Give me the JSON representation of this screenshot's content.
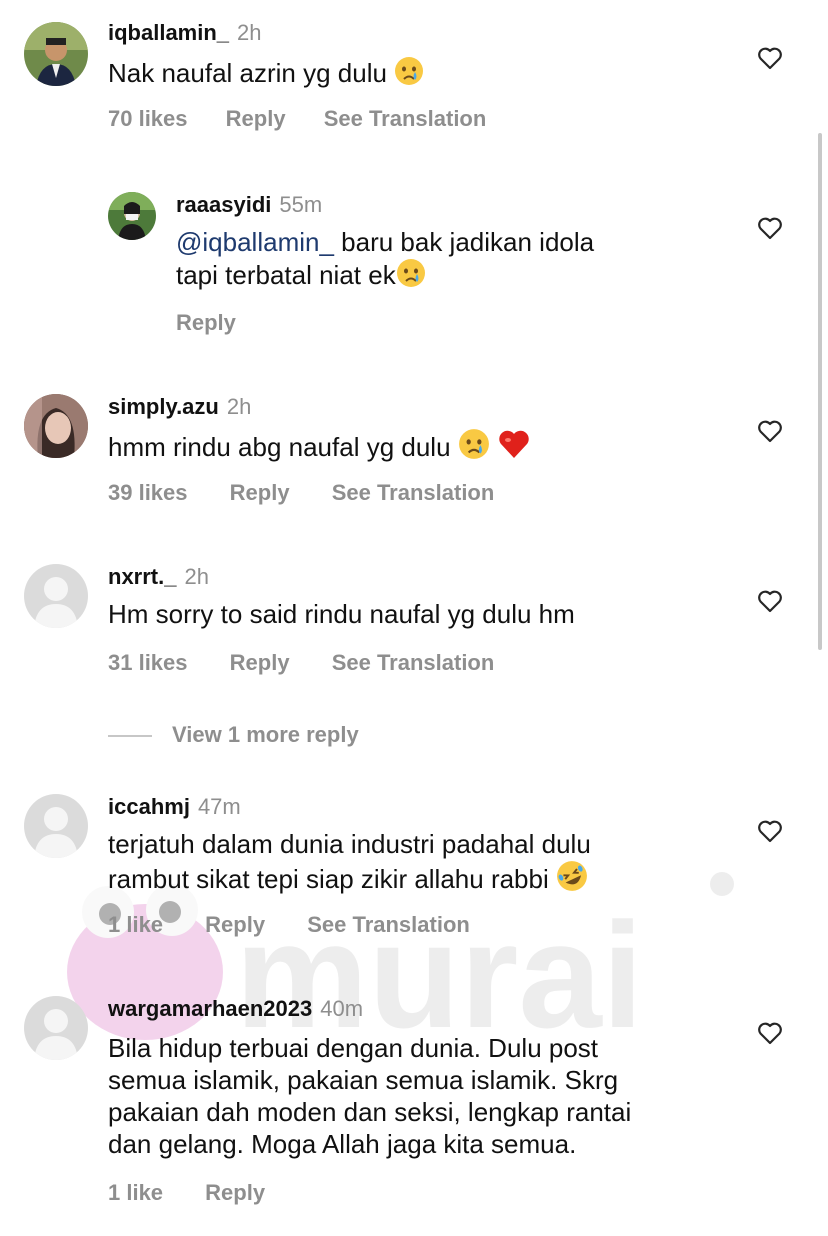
{
  "watermark": "murai",
  "comments": [
    {
      "username": "iqballamin_",
      "time": "2h",
      "text": "Nak naufal azrin yg dulu",
      "likes": "70 likes",
      "reply": "Reply",
      "translate": "See Translation",
      "emoji": "crying-face",
      "replies": [
        {
          "username": "raaasyidi",
          "time": "55m",
          "mention": "@iqballamin_",
          "text_line1": " baru bak jadikan idola",
          "text_line2": "tapi terbatal niat ek",
          "emoji": "crying-face",
          "reply": "Reply"
        }
      ]
    },
    {
      "username": "simply.azu",
      "time": "2h",
      "text": "hmm rindu abg naufal yg dulu ",
      "emoji": [
        "crying-face",
        "red-heart"
      ],
      "likes": "39 likes",
      "reply": "Reply",
      "translate": "See Translation"
    },
    {
      "username": "nxrrt._",
      "time": "2h",
      "text": "Hm sorry to said rindu naufal yg dulu hm",
      "likes": "31 likes",
      "reply": "Reply",
      "translate": "See Translation",
      "view_more": "View 1 more reply"
    },
    {
      "username": "iccahmj",
      "time": "47m",
      "text_line1": "terjatuh dalam dunia industri padahal dulu",
      "text_line2": "rambut sikat tepi siap zikir allahu rabbi ",
      "emoji": "rolling-laughing-face",
      "likes": "1 like",
      "reply": "Reply",
      "translate": "See Translation"
    },
    {
      "username": "wargamarhaen2023",
      "time": "40m",
      "text_lines": [
        "Bila hidup terbuai dengan dunia. Dulu post",
        "semua islamik, pakaian semua islamik. Skrg",
        "pakaian dah moden dan seksi, lengkap rantai",
        "dan gelang. Moga Allah jaga kita semua."
      ],
      "likes": "1 like",
      "reply": "Reply"
    }
  ],
  "colors": {
    "secondary_text": "#8e8e8e",
    "mention": "#1e3a6e",
    "heart_red": "#e0211b",
    "watermark": "#d86fb8"
  }
}
